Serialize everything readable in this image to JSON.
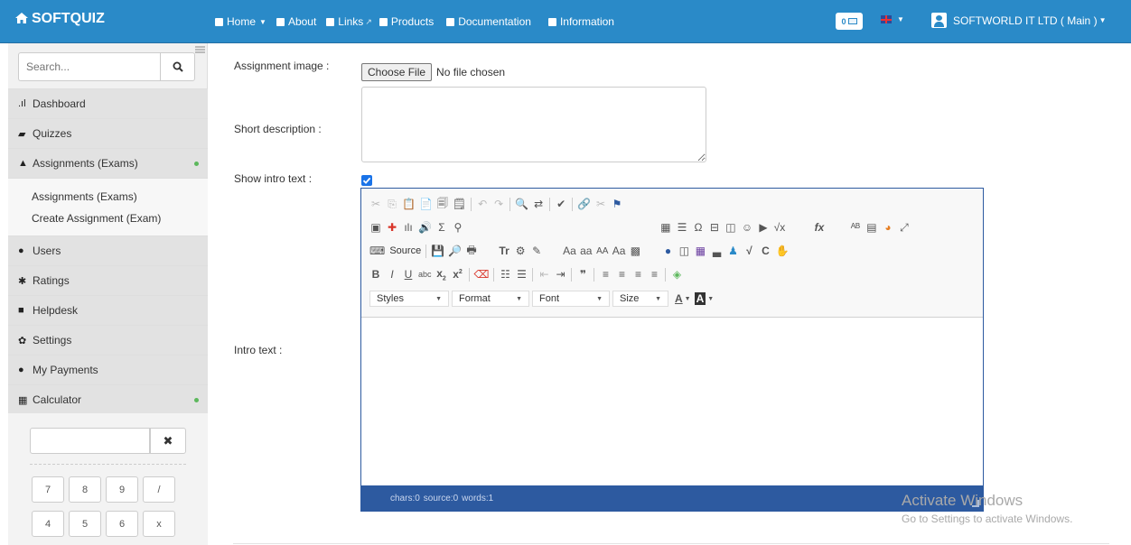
{
  "topbar": {
    "brand": "SOFTQUIZ",
    "nav": [
      {
        "label": "Home",
        "has_caret": true
      },
      {
        "label": "About",
        "has_caret": false
      },
      {
        "label": "Links",
        "has_caret": false,
        "external": true
      },
      {
        "label": "Products",
        "has_caret": false
      },
      {
        "label": "Documentation",
        "has_caret": false
      },
      {
        "label": "Information",
        "has_caret": false
      }
    ],
    "message_count": "0",
    "language_icon": "uk-flag-icon",
    "user_label": "SOFTWORLD IT LTD ( Main )"
  },
  "sidebar": {
    "search_placeholder": "Search...",
    "menu": [
      {
        "label": "Dashboard",
        "icon": "bar-chart-icon",
        "glyph": ".ıl"
      },
      {
        "label": "Quizzes",
        "icon": "folder-icon",
        "glyph": "▰"
      },
      {
        "label": "Assignments (Exams)",
        "icon": "bell-icon",
        "glyph": "▲",
        "active": true
      },
      {
        "label": "Users",
        "icon": "user-icon",
        "glyph": "●"
      },
      {
        "label": "Ratings",
        "icon": "asterisk-icon",
        "glyph": "✱"
      },
      {
        "label": "Helpdesk",
        "icon": "lock-icon",
        "glyph": "■"
      },
      {
        "label": "Settings",
        "icon": "gear-icon",
        "glyph": "✿"
      },
      {
        "label": "My Payments",
        "icon": "circle-arrow-icon",
        "glyph": "●"
      },
      {
        "label": "Calculator",
        "icon": "grid-icon",
        "glyph": "▦",
        "active": true
      }
    ],
    "submenu": [
      "Assignments (Exams)",
      "Create Assignment (Exam)"
    ],
    "calculator": {
      "clear_label": "✖",
      "keys_row1": [
        "7",
        "8",
        "9",
        "/"
      ],
      "keys_row2": [
        "4",
        "5",
        "6",
        "x"
      ]
    }
  },
  "form": {
    "assignment_image_label": "Assignment image :",
    "file_button": "Choose File",
    "file_status": "No file chosen",
    "short_description_label": "Short description :",
    "show_intro_label": "Show intro text :",
    "show_intro_checked": true,
    "intro_text_label": "Intro text :"
  },
  "editor": {
    "source_label": "Source",
    "combos": [
      "Styles",
      "Format",
      "Font",
      "Size"
    ],
    "status": {
      "chars": "chars:0",
      "source": "source:0",
      "words": "words:1"
    }
  },
  "watermark": {
    "line1": "Activate Windows",
    "line2": "Go to Settings to activate Windows."
  },
  "colors": {
    "topbar": "#2a8ac8",
    "editor_border": "#2d5aa0",
    "active_dot": "#5cb85c"
  }
}
